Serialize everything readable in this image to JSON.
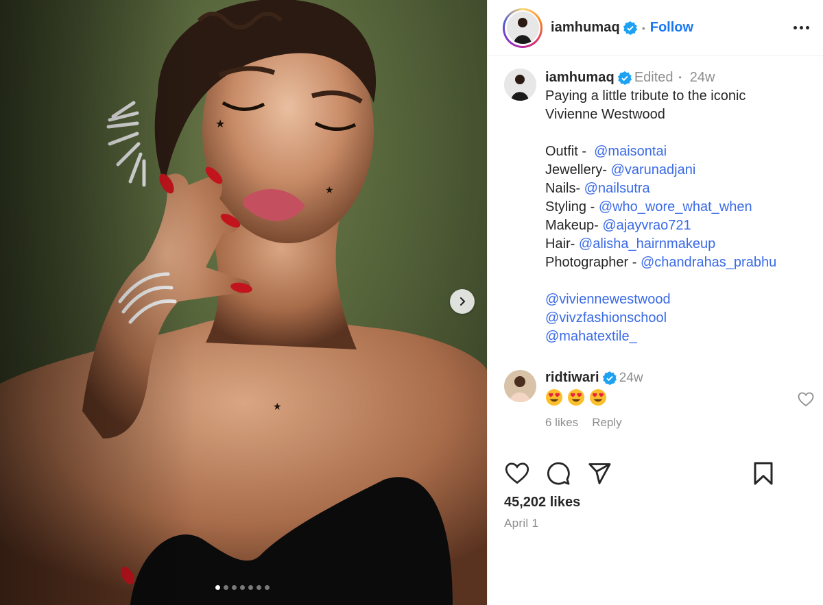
{
  "post": {
    "author": "iamhumaq",
    "follow_label": "Follow",
    "separator": "•",
    "carousel": {
      "slide_count": 7,
      "active_index": 0
    }
  },
  "caption": {
    "author": "iamhumaq",
    "edited_label": "Edited",
    "dot": "•",
    "time": "24w",
    "lines": [
      {
        "text": "Paying a little tribute to the iconic",
        "mention": ""
      },
      {
        "text": "Vivienne Westwood",
        "mention": ""
      },
      {
        "text": "",
        "mention": ""
      },
      {
        "text": "Outfit -  ",
        "mention": "@maisontai"
      },
      {
        "text": "Jewellery- ",
        "mention": "@varunadjani"
      },
      {
        "text": "Nails- ",
        "mention": "@nailsutra"
      },
      {
        "text": "Styling - ",
        "mention": "@who_wore_what_when"
      },
      {
        "text": "Makeup- ",
        "mention": "@ajayvrao721"
      },
      {
        "text": "Hair- ",
        "mention": "@alisha_hairnmakeup"
      },
      {
        "text": "Photographer - ",
        "mention": "@chandrahas_prabhu"
      },
      {
        "text": "",
        "mention": ""
      },
      {
        "text": "",
        "mention": "@viviennewestwood"
      },
      {
        "text": "",
        "mention": "@vivzfashionschool"
      },
      {
        "text": "",
        "mention": "@mahatextile_"
      }
    ]
  },
  "comment": {
    "author": "ridtiwari",
    "time": "24w",
    "emoji_count": 3,
    "likes_label": "6 likes",
    "reply_label": "Reply"
  },
  "stats": {
    "likes": "45,202 likes",
    "date": "April 1"
  },
  "colors": {
    "link": "#3a6ae6",
    "follow": "#1877f2",
    "verified": "#1da1f2",
    "muted": "#8e8e8e"
  },
  "icons": {
    "next": "chevron-right-icon",
    "like": "heart-icon",
    "comment": "comment-bubble-icon",
    "share": "paper-plane-icon",
    "save": "bookmark-icon",
    "more": "more-horizontal-icon",
    "verified": "verified-badge-icon"
  }
}
